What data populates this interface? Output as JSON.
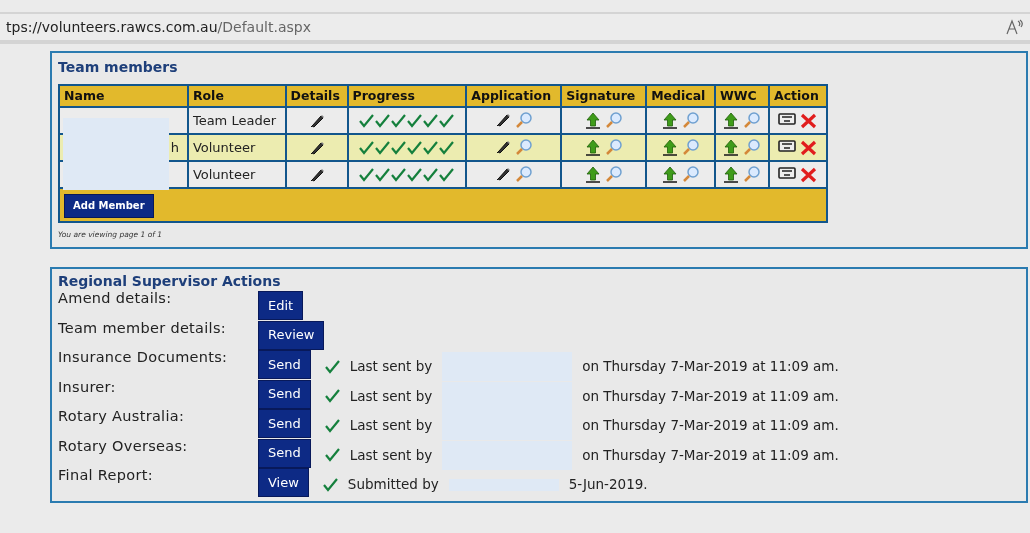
{
  "address_bar": {
    "url_host": "tps://volunteers.rawcs.com.au",
    "url_path": "/Default.aspx"
  },
  "team_members": {
    "title": "Team members",
    "columns": [
      "Name",
      "Role",
      "Details",
      "Progress",
      "Application",
      "Signature",
      "Medical",
      "WWC",
      "Action"
    ],
    "rows": [
      {
        "name": "",
        "role": "Team Leader",
        "selected": false,
        "progress": [
          true,
          true,
          true,
          true,
          true,
          true
        ]
      },
      {
        "name": "h",
        "role": "Volunteer",
        "selected": true,
        "progress": [
          true,
          true,
          true,
          true,
          true,
          true
        ]
      },
      {
        "name": "",
        "role": "Volunteer",
        "selected": false,
        "progress": [
          true,
          true,
          true,
          true,
          true,
          true
        ]
      }
    ],
    "add_button": "Add Member",
    "pager": "You are viewing page 1 of 1"
  },
  "supervisor_actions": {
    "title": "Regional Supervisor Actions",
    "items": [
      {
        "label": "Amend details:",
        "button": "Edit"
      },
      {
        "label": "Team member details:",
        "button": "Review"
      },
      {
        "label": "Insurance Documents:",
        "button": "Send",
        "done": true,
        "by": "Last sent by",
        "detail": "on Thursday 7-Mar-2019 at 11:09 am."
      },
      {
        "label": "Insurer:",
        "button": "Send",
        "done": true,
        "by": "Last sent by",
        "detail": "on Thursday 7-Mar-2019 at 11:09 am."
      },
      {
        "label": "Rotary Australia:",
        "button": "Send",
        "done": true,
        "by": "Last sent by",
        "detail": "on Thursday 7-Mar-2019 at 11:09 am."
      },
      {
        "label": "Rotary Overseas:",
        "button": "Send",
        "done": true,
        "by": "Last sent by",
        "detail": "on Thursday 7-Mar-2019 at 11:09 am."
      },
      {
        "label": "Final Report:",
        "button": "View",
        "done": true,
        "by": "Submitted by",
        "detail": "5-Jun-2019."
      }
    ]
  }
}
